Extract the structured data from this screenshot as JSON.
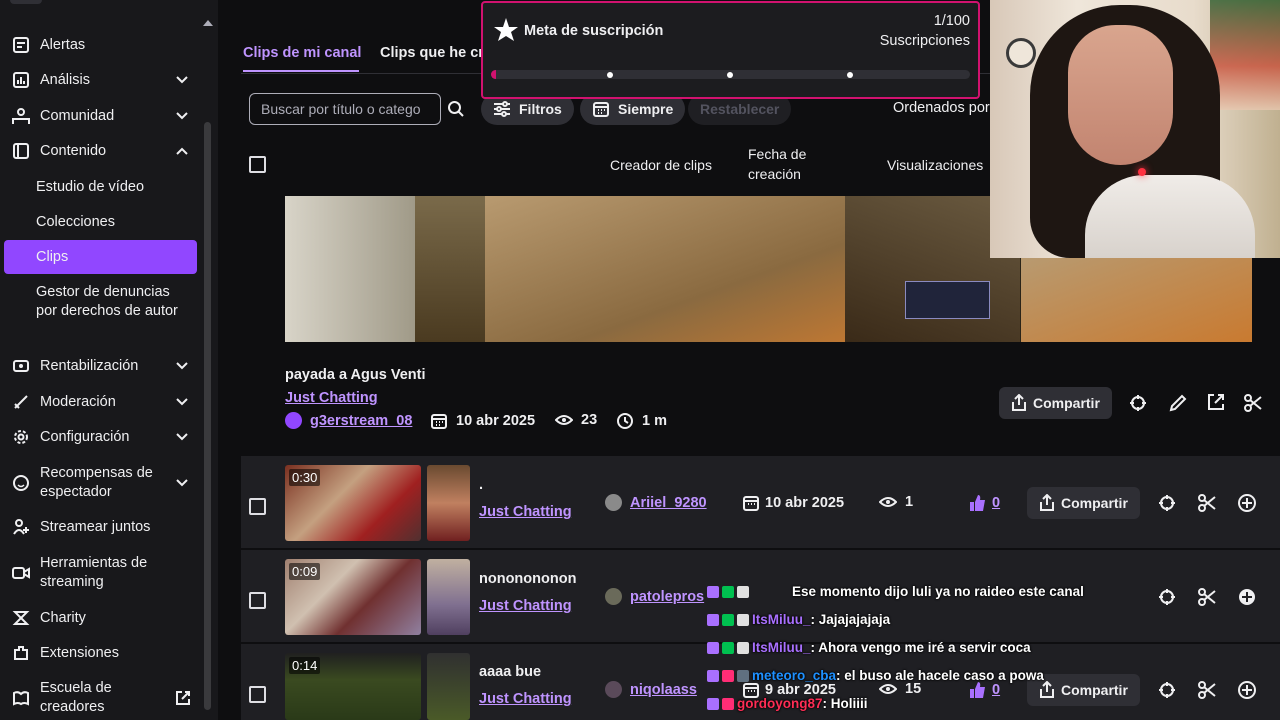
{
  "sidebar": {
    "items": [
      {
        "label": "Alertas"
      },
      {
        "label": "Análisis"
      },
      {
        "label": "Comunidad"
      },
      {
        "label": "Contenido"
      },
      {
        "label": "Rentabilización"
      },
      {
        "label": "Moderación"
      },
      {
        "label": "Configuración"
      },
      {
        "label": "Recompensas de espectador"
      },
      {
        "label": "Streamear juntos"
      },
      {
        "label": "Herramientas de streaming"
      },
      {
        "label": "Charity"
      },
      {
        "label": "Extensiones"
      },
      {
        "label": "Escuela de creadores"
      }
    ],
    "sub_items": [
      {
        "label": "Estudio de vídeo"
      },
      {
        "label": "Colecciones"
      },
      {
        "label": "Clips"
      },
      {
        "label": "Gestor de denuncias por derechos de autor"
      }
    ]
  },
  "tabs": [
    {
      "label": "Clips de mi canal"
    },
    {
      "label": "Clips que he cr"
    }
  ],
  "toolbar": {
    "search_placeholder": "Buscar por título o catego",
    "filters_label": "Filtros",
    "date_label": "Siempre",
    "reset_label": "Restablecer",
    "sort_label": "Ordenados por"
  },
  "table_headers": {
    "creator": "Creador de clips",
    "date": "Fecha de creación",
    "views": "Visualizaciones"
  },
  "featured_clip": {
    "title": "payada a Agus Venti",
    "category": "Just Chatting",
    "creator": "g3erstream_08",
    "date": "10 abr 2025",
    "views": "23",
    "duration": "1 m",
    "share_label": "Compartir"
  },
  "clips": [
    {
      "duration": "0:30",
      "title": ".",
      "category": "Just Chatting",
      "creator": "Ariiel_9280",
      "date": "10 abr 2025",
      "views": "1",
      "likes": "0",
      "share_label": "Compartir"
    },
    {
      "duration": "0:09",
      "title": "nononononon",
      "category": "Just Chatting",
      "creator": "patolepros",
      "date": "",
      "views": "",
      "likes": "",
      "share_label": ""
    },
    {
      "duration": "0:14",
      "title": "aaaa bue",
      "category": "Just Chatting",
      "creator": "niqolaass",
      "date": "9 abr 2025",
      "views": "15",
      "likes": "0",
      "share_label": "Compartir"
    }
  ],
  "overlay": {
    "goal_title": "Meta de suscripción",
    "goal_count": "1/100",
    "goal_unit": "Suscripciones",
    "goal_progress": 0.01,
    "chat": [
      {
        "user": "",
        "message": "Ese momento dijo luli ya no raideo este canal",
        "color": "#bf94ff"
      },
      {
        "user": "ItsMiluu_",
        "message": ": Jajajajajaja",
        "color": "#a970ff"
      },
      {
        "user": "ItsMiluu_",
        "message": ": Ahora vengo me iré a servir coca",
        "color": "#a970ff"
      },
      {
        "user": "meteoro_cba",
        "message": ": el buso ale hacele caso a powa",
        "color": "#1e90ff"
      },
      {
        "user": "gordoyong87",
        "message": ": Holiiii",
        "color": "#ff2d55"
      }
    ]
  },
  "colors": {
    "accent": "#9147ff",
    "link": "#bf94ff",
    "goal_border": "#d1126f"
  }
}
